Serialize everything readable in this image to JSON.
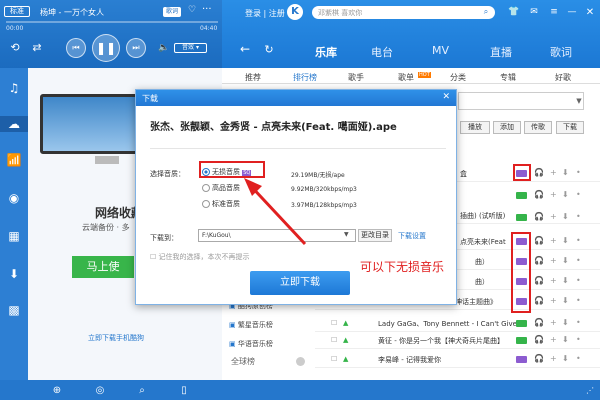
{
  "player": {
    "quality": "标准",
    "artist_title": "杨坤 - 一万个女人",
    "lyrics_btn": "歌词",
    "time_current": "00:00",
    "time_total": "04:40",
    "audio_effect": "音效"
  },
  "account": {
    "login": "登录",
    "register": "注册",
    "search_placeholder": "邓紫棋 喜欢你"
  },
  "main_tabs": [
    "乐库",
    "电台",
    "MV",
    "直播",
    "歌词"
  ],
  "sub_tabs": [
    "推荐",
    "排行榜",
    "歌手",
    "歌单",
    "分类",
    "专辑",
    "好歌"
  ],
  "sub_tab_badge": "HOT",
  "left_panel": {
    "title": "网络收藏",
    "desc": "云端备份 · 多",
    "button": "马上使",
    "link": "立即下载手机酷狗"
  },
  "rank_list": {
    "items": [
      "酷狗原创榜",
      "繁星音乐榜",
      "华语音乐榜"
    ],
    "section": "全球榜"
  },
  "action_buttons": [
    "播放",
    "添加",
    "传歌",
    "下载"
  ],
  "songs": [
    {
      "title": "盒",
      "partial": true
    },
    {
      "title": "插曲) (试听版)",
      "partial": true
    },
    {
      "title": "点亮未来(Feat",
      "partial": true
    },
    {
      "title": "曲）",
      "partial": true
    },
    {
      "title": "曲）",
      "partial": true
    },
    {
      "title": "神话主题曲》",
      "partial": true
    },
    {
      "title": "Lady GaGa、Tony Bennett - I Can't Give...",
      "partial": false
    },
    {
      "title": "黄征 - 你是另一个我【神犬奇兵片尾曲】",
      "partial": false
    },
    {
      "title": "李易峰 - 记得我爱你",
      "partial": false
    }
  ],
  "dialog": {
    "title": "下载",
    "song": "张杰、张靓颖、金秀贤 - 点亮未来(Feat. 噶面娅).ape",
    "quality_label": "选择音质：",
    "options": [
      {
        "label": "无损音质",
        "info": "29.19MB/无损/ape",
        "badge": "SQ",
        "selected": true
      },
      {
        "label": "高品音质",
        "info": "9.92MB/320kbps/mp3",
        "badge": "",
        "selected": false
      },
      {
        "label": "标准音质",
        "info": "3.97MB/128kbps/mp3",
        "badge": "",
        "selected": false
      }
    ],
    "save_label": "下载到：",
    "save_path": "F:\\KuGou\\",
    "change_dir": "更改目录",
    "download_settings": "下载设置",
    "remember": "记住我的选择，本次不再提示",
    "download_btn": "立即下载"
  },
  "annotation": "可以下无损音乐",
  "colors": {
    "accent": "#2577cc",
    "red": "#e02020",
    "sq_badge": "#8c5cd0",
    "hq_badge": "#35b44a"
  }
}
